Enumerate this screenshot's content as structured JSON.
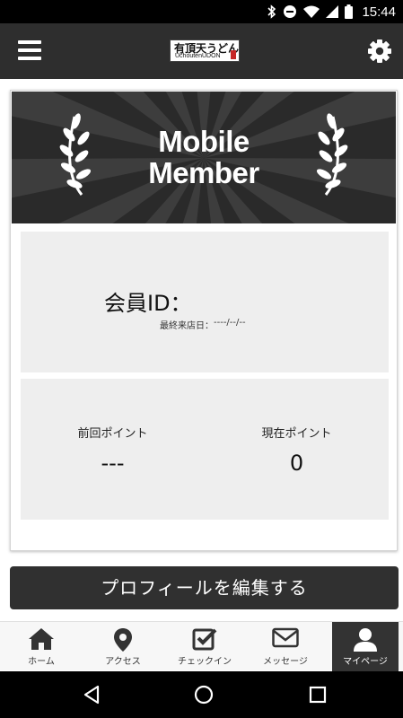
{
  "status_bar": {
    "time": "15:44"
  },
  "app_bar": {
    "logo_text": "有頂天うどん",
    "logo_subtext": "UchoutenUDON"
  },
  "member_card": {
    "banner_title_line1": "Mobile",
    "banner_title_line2": "Member",
    "member_id_label": "会員ID：",
    "member_id_value": "",
    "last_visit_label": "最終来店日：",
    "last_visit_value": "----/--/--",
    "previous_points_label": "前回ポイント",
    "previous_points_value": "---",
    "current_points_label": "現在ポイント",
    "current_points_value": "0"
  },
  "edit_profile_button": "プロフィールを編集する",
  "bottom_nav": {
    "items": [
      {
        "label": "ホーム",
        "icon": "home-icon"
      },
      {
        "label": "アクセス",
        "icon": "map-pin-icon"
      },
      {
        "label": "チェックイン",
        "icon": "checkbox-icon"
      },
      {
        "label": "メッセージ",
        "icon": "mail-icon"
      },
      {
        "label": "マイページ",
        "icon": "user-icon",
        "active": true
      }
    ]
  },
  "colors": {
    "app_bar": "#2e2e2e",
    "panel": "#eeeeee",
    "button": "#303030",
    "active_tab": "#333333"
  }
}
